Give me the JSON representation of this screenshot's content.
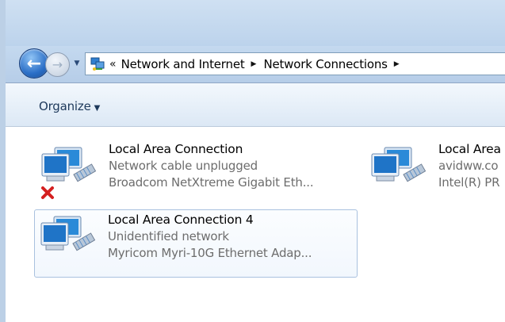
{
  "window": {
    "breadcrumb": {
      "overflow": "«",
      "items": [
        {
          "label": "Network and Internet"
        },
        {
          "label": "Network Connections"
        }
      ]
    }
  },
  "toolbar": {
    "organize_label": "Organize"
  },
  "connections": [
    {
      "name": "Local Area Connection",
      "status": "Network cable unplugged",
      "adapter": "Broadcom NetXtreme Gigabit Eth...",
      "disconnected": true,
      "selected": false
    },
    {
      "name": "Local Area Connection 4",
      "status": "Unidentified network",
      "adapter": "Myricom Myri-10G Ethernet Adap...",
      "disconnected": false,
      "selected": true
    },
    {
      "name": "Local Area",
      "status": "avidww.co",
      "adapter": "Intel(R) PR",
      "disconnected": false,
      "selected": false
    }
  ],
  "icons": {
    "back": "back-arrow-icon",
    "forward": "forward-arrow-icon",
    "history": "chevron-down-icon",
    "location": "network-connections-icon",
    "breadcrumb_separator": "triangle-right-icon",
    "connection": "network-adapter-icon",
    "disconnected": "red-x-icon"
  },
  "colors": {
    "chrome_top": "#cfe0f2",
    "chrome_bottom": "#b6cde8",
    "toolbar": "#e8f0f9",
    "selection_border": "#a9c1df",
    "secondary_text": "#6d6d6d",
    "error_red": "#d42020"
  }
}
